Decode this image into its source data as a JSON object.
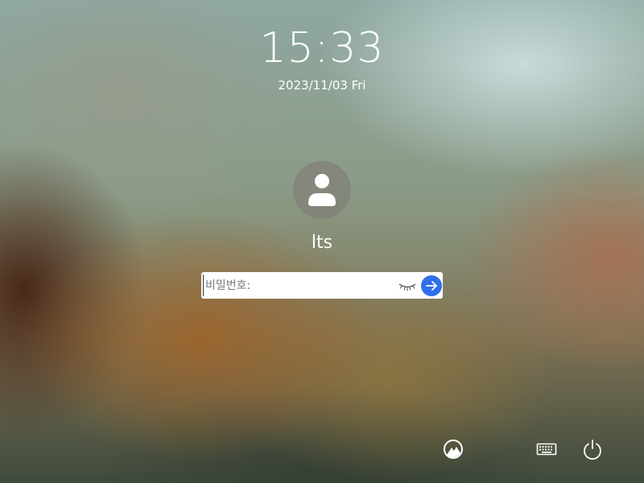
{
  "lock_screen": {
    "time": "15:33",
    "date": "2023/11/03 Fri",
    "username": "lts",
    "password_placeholder": "비밀번호:"
  },
  "icons": {
    "avatar": "user-avatar-icon",
    "show_password": "eye-closed-icon",
    "submit": "arrow-right-icon",
    "wallpaper": "wallpaper-mountain-icon",
    "keyboard": "keyboard-icon",
    "power": "power-icon"
  },
  "colors": {
    "accent": "#2f6fe8",
    "text": "#ffffff"
  }
}
